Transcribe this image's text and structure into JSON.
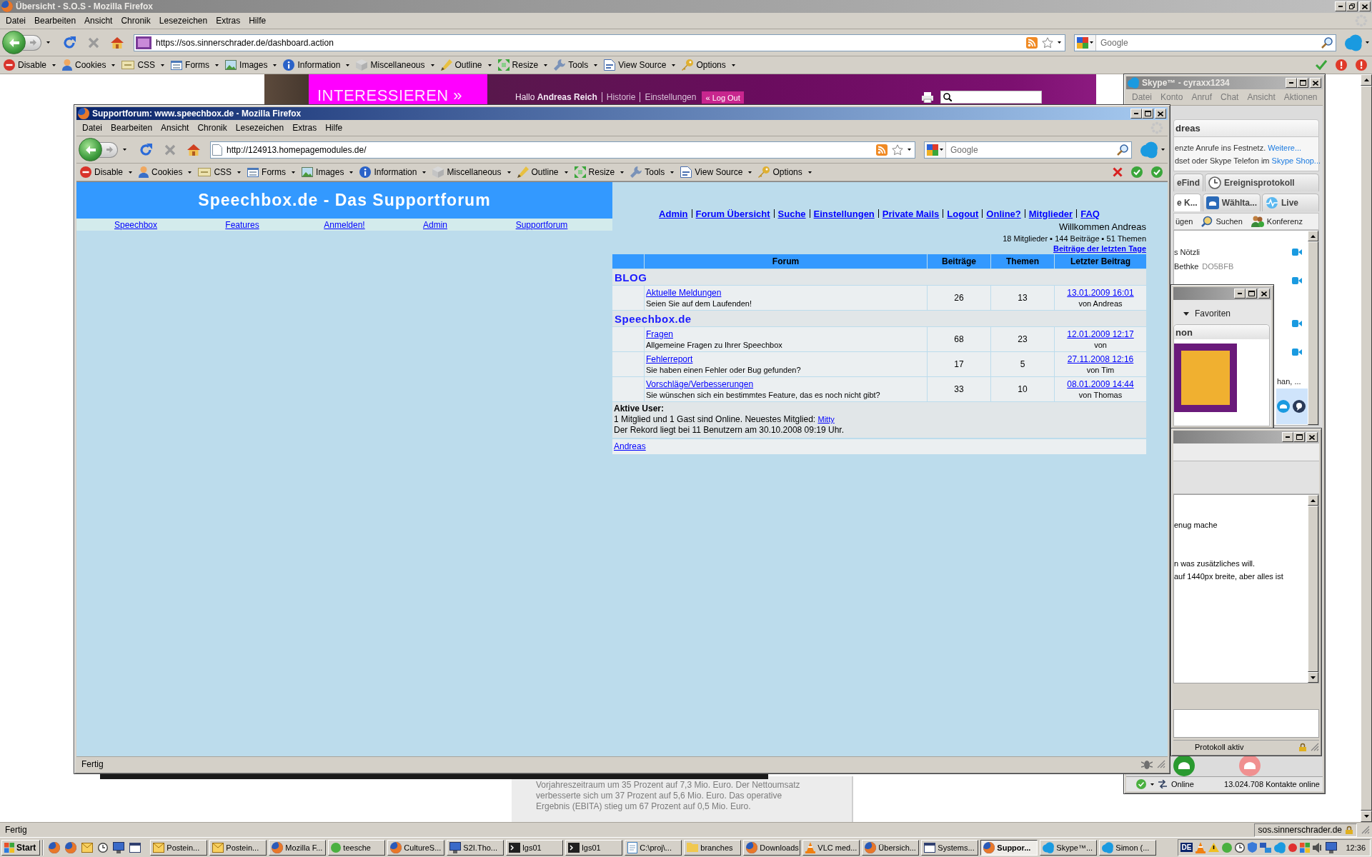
{
  "browser": {
    "title": "Übersicht - S.O.S - Mozilla Firefox",
    "active": false,
    "menu": [
      "Datei",
      "Bearbeiten",
      "Ansicht",
      "Chronik",
      "Lesezeichen",
      "Extras",
      "Hilfe"
    ],
    "url": "https://sos.sinnerschrader.de/dashboard.action",
    "search_placeholder": "Google",
    "toolbar": [
      {
        "label": "Disable",
        "kind": "disable"
      },
      {
        "label": "Cookies",
        "kind": "cookies"
      },
      {
        "label": "CSS",
        "kind": "css"
      },
      {
        "label": "Forms",
        "kind": "forms"
      },
      {
        "label": "Images",
        "kind": "images"
      },
      {
        "label": "Information",
        "kind": "information"
      },
      {
        "label": "Miscellaneous",
        "kind": "misc"
      },
      {
        "label": "Outline",
        "kind": "outline"
      },
      {
        "label": "Resize",
        "kind": "resize"
      },
      {
        "label": "Tools",
        "kind": "tools"
      },
      {
        "label": "View Source",
        "kind": "source"
      },
      {
        "label": "Options",
        "kind": "options"
      }
    ],
    "status": "Fertig",
    "status_host": "sos.sinnerschrader.de"
  },
  "page": {
    "banner": "INTERESSIEREN »",
    "greeting": "Hallo **Andreas Reich**",
    "links": [
      "Historie",
      "Einstellungen"
    ],
    "logout": "« Log Out",
    "article": [
      "Vorjahreszeitraum um 35 Prozent auf 7,3 Mio. Euro. Der Nettoumsatz",
      "verbesserte sich um 37 Prozent auf 5,6 Mio. Euro. Das operative",
      "Ergebnis (EBITA) stieg um 67 Prozent auf 0,5 Mio. Euro."
    ]
  },
  "forum_window": {
    "title": "Supportforum: www.speechbox.de - Mozilla Firefox",
    "active": true,
    "menu": [
      "Datei",
      "Bearbeiten",
      "Ansicht",
      "Chronik",
      "Lesezeichen",
      "Extras",
      "Hilfe"
    ],
    "url": "http://124913.homepagemodules.de/",
    "search_placeholder": "Google",
    "toolbar": [
      {
        "label": "Disable",
        "kind": "disable"
      },
      {
        "label": "Cookies",
        "kind": "cookies"
      },
      {
        "label": "CSS",
        "kind": "css"
      },
      {
        "label": "Forms",
        "kind": "forms"
      },
      {
        "label": "Images",
        "kind": "images"
      },
      {
        "label": "Information",
        "kind": "information"
      },
      {
        "label": "Miscellaneous",
        "kind": "misc"
      },
      {
        "label": "Outline",
        "kind": "outline"
      },
      {
        "label": "Resize",
        "kind": "resize"
      },
      {
        "label": "Tools",
        "kind": "tools"
      },
      {
        "label": "View Source",
        "kind": "source"
      },
      {
        "label": "Options",
        "kind": "options"
      }
    ],
    "status": "Fertig",
    "site_title": "Speechbox.de - Das Supportforum",
    "site_links": [
      "Speechbox",
      "Features",
      "Anmelden!",
      "Admin",
      "Supportforum"
    ],
    "nav_links": [
      "Admin",
      "Forum Übersicht",
      "Suche",
      "Einstellungen",
      "Private Mails",
      "Logout",
      "Online?",
      "Mitglieder",
      "FAQ"
    ],
    "welcome": "Willkommen Andreas",
    "stats": "18 Mitglieder ▪ 144 Beiträge ▪ 51 Themen",
    "recent_link": "Beiträge der letzten Tage",
    "columns": [
      "Forum",
      "Beiträge",
      "Themen",
      "Letzter Beitrag"
    ],
    "categories": [
      {
        "name": "BLOG",
        "forums": [
          {
            "title": "Aktuelle Meldungen",
            "description": "Seien Sie auf dem Laufenden!",
            "posts": "26",
            "topics": "13",
            "last_post": "13.01.2009 16:01",
            "last_author": "von Andreas"
          }
        ]
      },
      {
        "name": "Speechbox.de",
        "forums": [
          {
            "title": "Fragen",
            "description": "Allgemeine Fragen zu Ihrer Speechbox",
            "posts": "68",
            "topics": "23",
            "last_post": "12.01.2009 12:17",
            "last_author": "von"
          },
          {
            "title": "Fehlerreport",
            "description": "Sie haben einen Fehler oder Bug gefunden?",
            "posts": "17",
            "topics": "5",
            "last_post": "27.11.2008 12:16",
            "last_author": "von Tim"
          },
          {
            "title": "Vorschläge/Verbesserungen",
            "description": "Sie wünschen sich ein bestimmtes Feature, das es noch nicht gibt?",
            "posts": "33",
            "topics": "10",
            "last_post": "08.01.2009 14:44",
            "last_author": "von Thomas"
          }
        ]
      }
    ],
    "active_users": {
      "heading": "Aktive User:",
      "summary": "1 Mitglied und 1 Gast sind Online. Neuestes Mitglied:",
      "newest_member": "Mitty",
      "record": "Der Rekord liegt bei 11 Benutzern am 30.10.2008 09:19 Uhr."
    },
    "online_users": [
      "Andreas"
    ]
  },
  "skype": {
    "title": "Skype™ - cyraxx1234",
    "active": false,
    "menu": [
      "Datei",
      "Konto",
      "Anruf",
      "Chat",
      "Ansicht",
      "Aktionen"
    ],
    "profile_name": "dreas",
    "promo": [
      {
        "text": "enzte Anrufe ins Festnetz.",
        "link": "Weitere..."
      },
      {
        "text": "dset oder Skype Telefon im",
        "link": "Skype Shop..."
      }
    ],
    "tabs": [
      {
        "label": "eFind",
        "kind": "plain",
        "selected": false
      },
      {
        "label": "Ereignisprotokoll",
        "kind": "clock",
        "selected": false
      }
    ],
    "tabs_2": [
      {
        "label": "e K...",
        "kind": "plain",
        "selected": true
      },
      {
        "label": "Wählta...",
        "kind": "phone",
        "selected": false
      },
      {
        "label": "Live",
        "kind": "pulse",
        "selected": false
      }
    ],
    "actions": [
      {
        "label": "ügen",
        "kind": "plain"
      },
      {
        "label": "Suchen",
        "kind": "search"
      },
      {
        "label": "Konferenz",
        "kind": "conference"
      }
    ],
    "contacts": [
      {
        "name": "s Nötzli",
        "video": true,
        "selected": false
      },
      {
        "name": "Bethke",
        "note": "DO5BFB",
        "video": false,
        "selected": false
      },
      {
        "video": true,
        "selected": false
      },
      {
        "video": true,
        "selected": false
      },
      {
        "video": true,
        "selected": false
      },
      {
        "name": "han, ...",
        "video": false,
        "selected": false
      },
      {
        "video": false,
        "selected": true
      }
    ],
    "status": "Online",
    "online_count": "13.024.708 Kontakte online"
  },
  "favorites_window": {
    "active": false,
    "group": "Favoriten",
    "expanded": true,
    "panel_title": "non"
  },
  "chat_window": {
    "active": false,
    "messages": [
      "enug mache",
      "n was zusätzliches will.",
      "auf 1440px breite, aber alles ist"
    ],
    "status": "Protokoll aktiv"
  },
  "taskbar": {
    "start": "Start",
    "items": [
      {
        "label": "Postein...",
        "kind": "mail",
        "selected": false
      },
      {
        "label": "Postein...",
        "kind": "mail",
        "selected": false
      },
      {
        "label": "Mozilla F...",
        "kind": "browser",
        "selected": false
      },
      {
        "label": "teesche",
        "kind": "status",
        "selected": false
      },
      {
        "label": "CultureS...",
        "kind": "browser",
        "selected": false
      },
      {
        "label": "S2I.Tho...",
        "kind": "remote",
        "selected": false
      },
      {
        "label": "lgs01",
        "kind": "terminal",
        "selected": false
      },
      {
        "label": "lgs01",
        "kind": "terminal",
        "selected": false
      },
      {
        "label": "C:\\proj\\...",
        "kind": "editor",
        "selected": false
      },
      {
        "label": "branches",
        "kind": "folder",
        "selected": false
      },
      {
        "label": "Downloads",
        "kind": "browser",
        "selected": false
      },
      {
        "label": "VLC med...",
        "kind": "cone",
        "selected": false
      },
      {
        "label": "Übersich...",
        "kind": "browser",
        "selected": false
      },
      {
        "label": "Systems...",
        "kind": "window",
        "selected": false
      },
      {
        "label": "Suppor...",
        "kind": "browser",
        "selected": true
      },
      {
        "label": "Skype™...",
        "kind": "skype",
        "selected": false
      },
      {
        "label": "Simon (...",
        "kind": "skype",
        "selected": false
      }
    ],
    "language": "DE",
    "clock": "12:36"
  }
}
